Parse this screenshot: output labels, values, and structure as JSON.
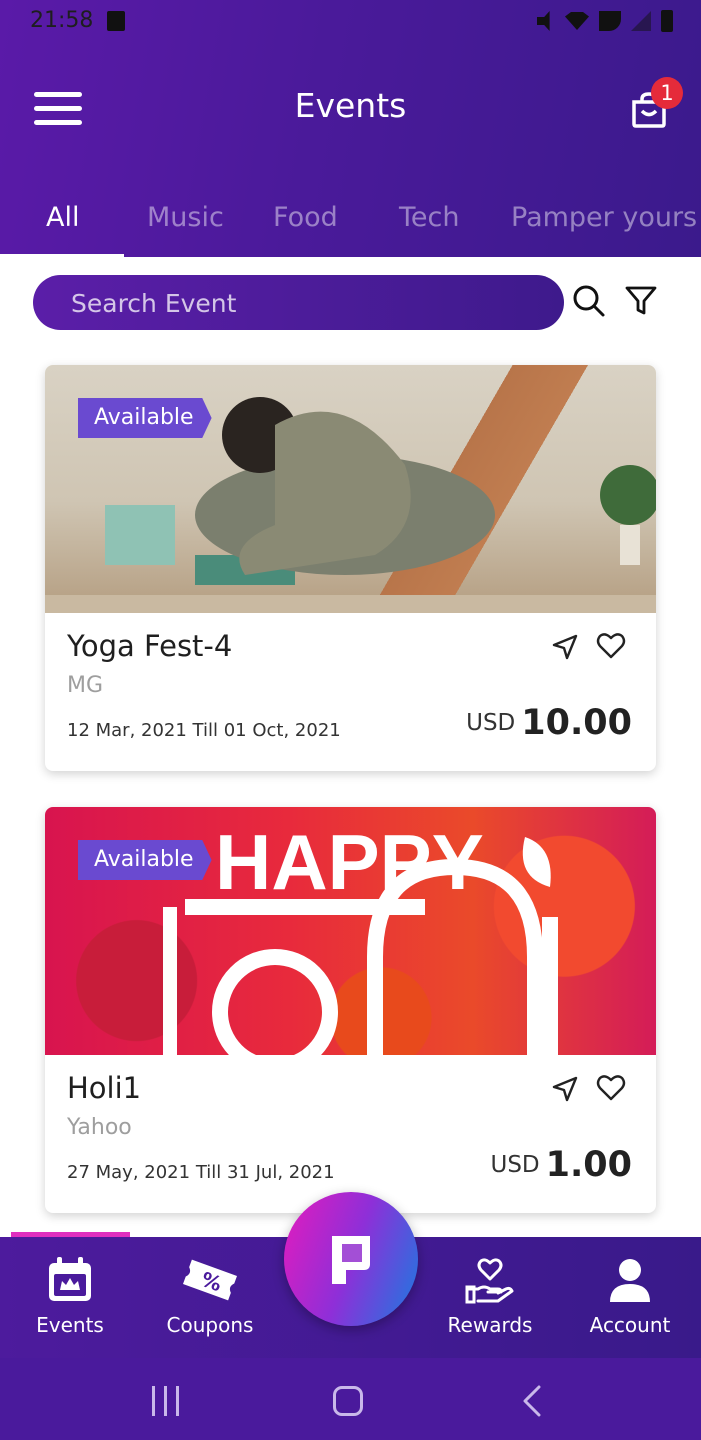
{
  "status_bar": {
    "time": "21:58"
  },
  "header": {
    "title": "Events",
    "cart_count": "1"
  },
  "tabs": [
    {
      "label": "All",
      "active": true
    },
    {
      "label": "Music",
      "active": false
    },
    {
      "label": "Food",
      "active": false
    },
    {
      "label": "Tech",
      "active": false
    },
    {
      "label": "Pamper yours",
      "active": false
    }
  ],
  "search": {
    "placeholder": "Search Event"
  },
  "events": [
    {
      "badge": "Available",
      "title": "Yoga Fest-4",
      "organizer": "MG",
      "dates": "12 Mar, 2021 Till 01 Oct, 2021",
      "currency": "USD",
      "price": "10.00",
      "image": "yoga-photo"
    },
    {
      "badge": "Available",
      "title": "Holi1",
      "organizer": "Yahoo",
      "dates": "27 May, 2021 Till 31 Jul, 2021",
      "currency": "USD",
      "price": "1.00",
      "image": "happy-holi-banner"
    }
  ],
  "bottom_nav": [
    {
      "label": "Events",
      "icon": "calendar-icon",
      "active": true
    },
    {
      "label": "Coupons",
      "icon": "coupon-icon",
      "active": false
    },
    {
      "label": "Rewards",
      "icon": "rewards-icon",
      "active": false
    },
    {
      "label": "Account",
      "icon": "account-icon",
      "active": false
    }
  ],
  "colors": {
    "primary": "#4a1a9a",
    "badge": "#6a4ad0",
    "cart_badge": "#e52b3a",
    "nav_active": "#e02fbf"
  }
}
